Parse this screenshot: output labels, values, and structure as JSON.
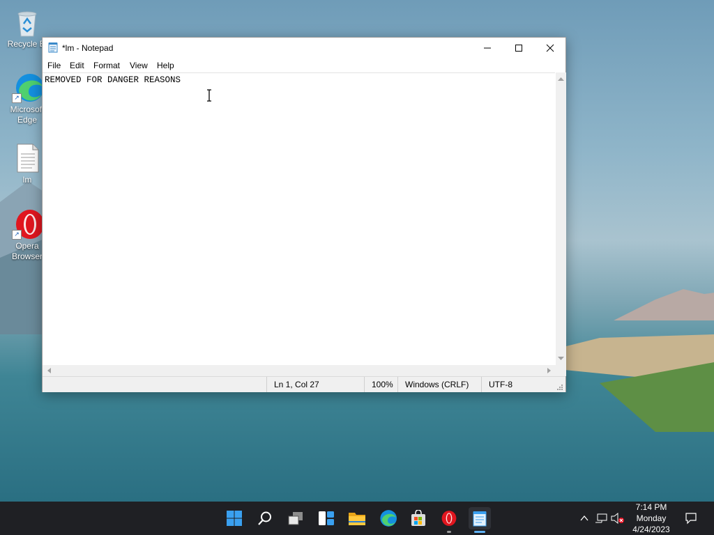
{
  "desktop": {
    "icons": [
      {
        "label": "Recycle Bin",
        "display": "Recycle Bi"
      },
      {
        "label": "Microsoft Edge",
        "display": "Microsoft\nEdge"
      },
      {
        "label": "lm",
        "display": "lm"
      },
      {
        "label": "Opera Browser",
        "display": "Opera\nBrowser"
      }
    ]
  },
  "window": {
    "title": "*lm - Notepad",
    "menu": [
      "File",
      "Edit",
      "Format",
      "View",
      "Help"
    ],
    "content": "REMOVED FOR DANGER REASONS",
    "status": {
      "position": "Ln 1, Col 27",
      "zoom": "100%",
      "line_ending": "Windows (CRLF)",
      "encoding": "UTF-8"
    }
  },
  "taskbar": {
    "clock": {
      "time": "7:14 PM",
      "day": "Monday",
      "date": "4/24/2023"
    },
    "icons": [
      "start-icon",
      "search-icon",
      "task-view-icon",
      "widgets-icon",
      "file-explorer-icon",
      "edge-icon",
      "store-icon",
      "opera-icon",
      "notepad-icon"
    ]
  },
  "colors": {
    "accent": "#0078d4",
    "taskbar": "#1f2024",
    "opera_red": "#e0161f"
  }
}
